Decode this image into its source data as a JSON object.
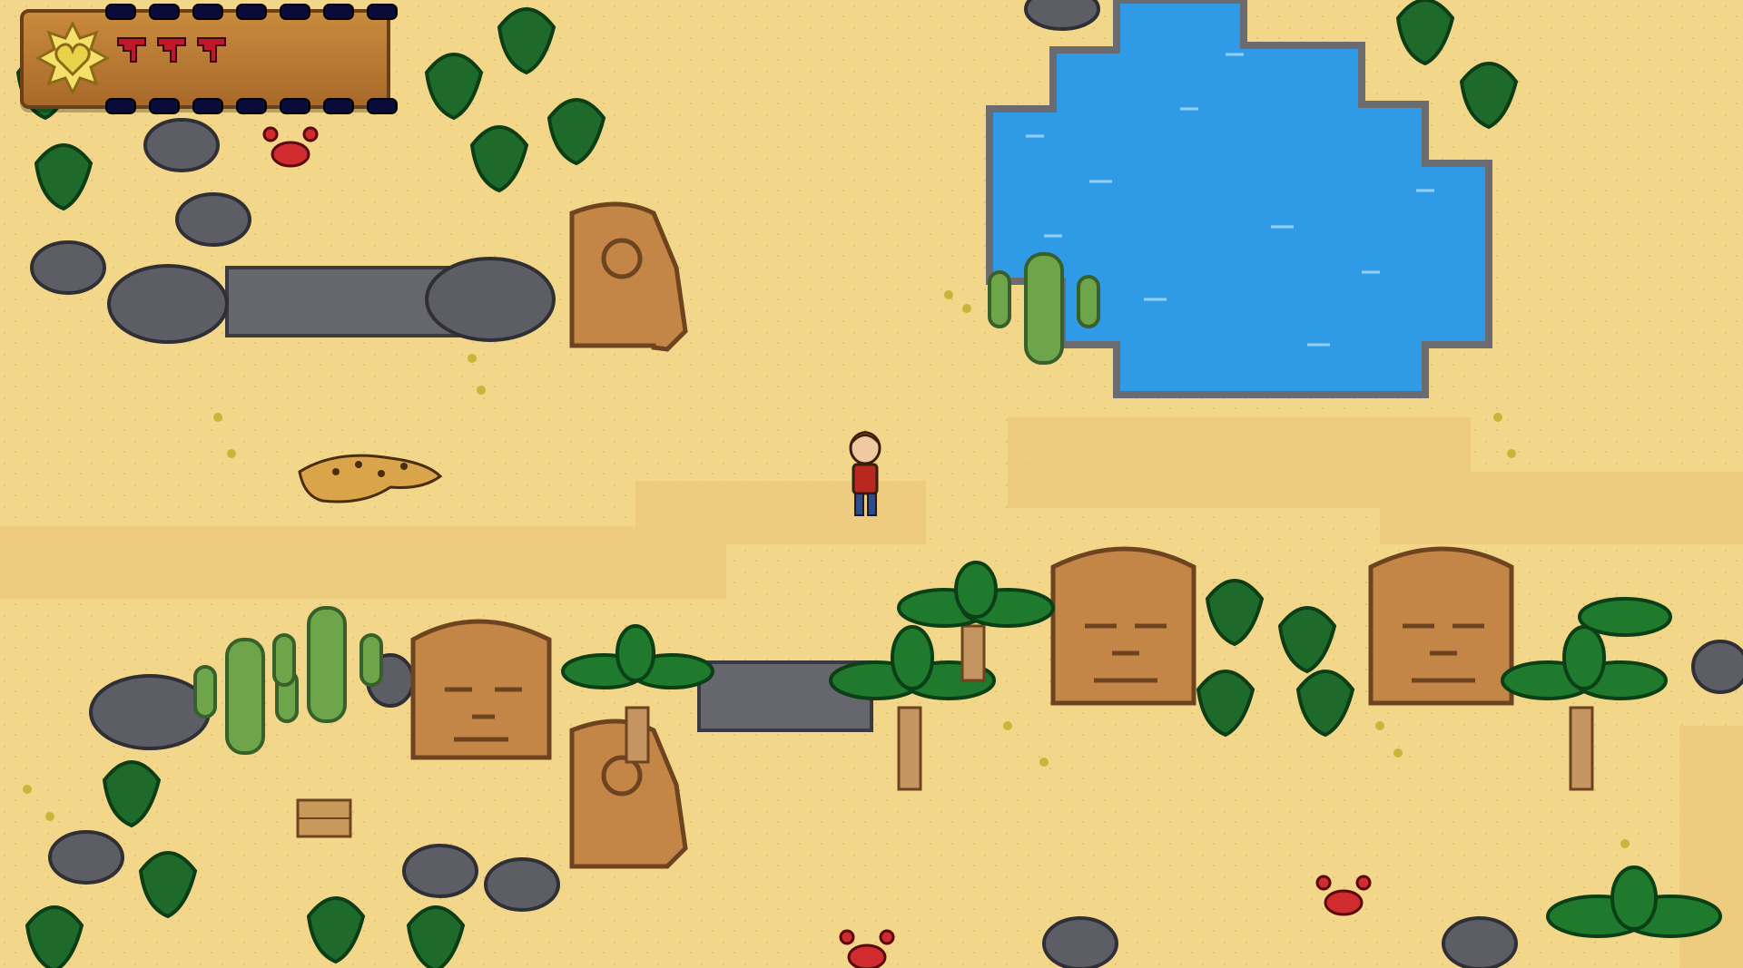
{
  "hud": {
    "health_hearts_filled": 3,
    "health_hearts_total": 3,
    "emblem_icon": "sun-heart-icon",
    "colors": {
      "frame": "#a96a2a",
      "emblem": "#f4e06a",
      "heart": "#c0182a"
    }
  },
  "scene": {
    "environment": "desert-oasis",
    "colors": {
      "sand": "#f2d78a",
      "path": "#e8c877",
      "water": "#33a6ee",
      "rock": "#6d6d78",
      "foliage": "#1f6b2c"
    },
    "entities": [
      "player-character",
      "jaguar",
      "crab",
      "crab",
      "crab",
      "olmec-head-statue",
      "olmec-head-statue",
      "olmec-head-statue",
      "olmec-side-statue",
      "olmec-side-statue",
      "oasis-pond",
      "cactus",
      "cactus",
      "cactus",
      "palm-tree",
      "palm-tree",
      "palm-tree",
      "palm-tree",
      "wooden-crate"
    ]
  }
}
